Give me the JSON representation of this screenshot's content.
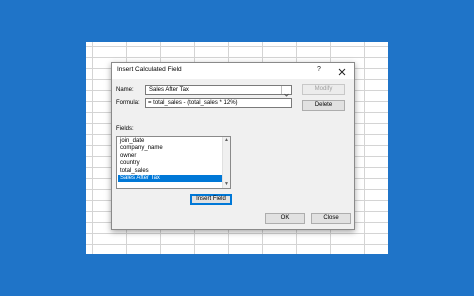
{
  "dialog": {
    "title": "Insert Calculated Field",
    "help_label": "?",
    "name_label": "Name:",
    "name_value": "Sales After Tax",
    "formula_label": "Formula:",
    "formula_value": "= total_sales - (total_sales * 12%)",
    "modify_label": "Modify",
    "delete_label": "Delete",
    "fields_label": "Fields:",
    "fields": [
      "join_date",
      "company_name",
      "owner",
      "country",
      "total_sales",
      "Sales After Tax"
    ],
    "selected_field_index": 5,
    "insert_field_label": "Insert Field",
    "ok_label": "OK",
    "close_label": "Close"
  },
  "colors": {
    "desktop_bg": "#1f74c8",
    "selection": "#0078d7"
  }
}
